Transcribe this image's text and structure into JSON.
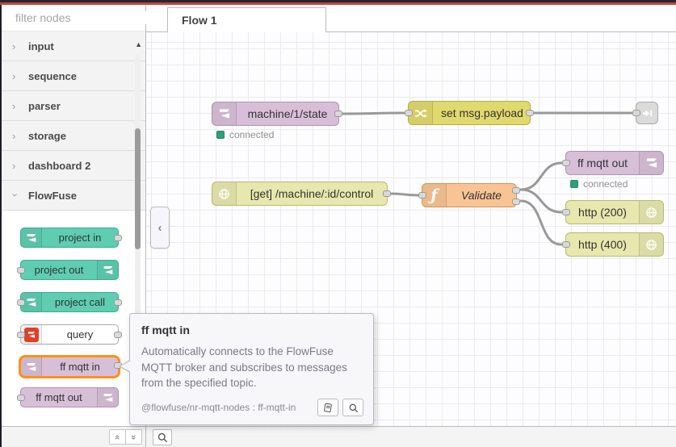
{
  "palette": {
    "search_placeholder": "filter nodes",
    "categories": [
      {
        "label": "input"
      },
      {
        "label": "sequence"
      },
      {
        "label": "parser"
      },
      {
        "label": "storage"
      },
      {
        "label": "dashboard 2"
      },
      {
        "label": "FlowFuse",
        "expanded": true
      }
    ],
    "nodes": [
      {
        "label": "project in"
      },
      {
        "label": "project out"
      },
      {
        "label": "project call"
      },
      {
        "label": "query"
      },
      {
        "label": "ff mqtt in",
        "highlighted": true
      },
      {
        "label": "ff mqtt out"
      }
    ]
  },
  "workspace": {
    "tab": {
      "label": "Flow 1"
    },
    "flow_nodes": [
      {
        "label": "machine/1/state",
        "type": "ff mqtt in",
        "status": "connected"
      },
      {
        "label": "set msg.payload",
        "type": "change"
      },
      {
        "label": "",
        "type": "link out"
      },
      {
        "label": "[get] /machine/:id/control",
        "type": "http in"
      },
      {
        "label": "Validate",
        "type": "function"
      },
      {
        "label": "ff mqtt out",
        "type": "ff mqtt out",
        "status": "connected"
      },
      {
        "label": "http (200)",
        "type": "http response"
      },
      {
        "label": "http (400)",
        "type": "http response"
      }
    ]
  },
  "tooltip": {
    "title": "ff mqtt in",
    "description": "Automatically connects to the FlowFuse MQTT broker and subscribes to messages from the specified topic.",
    "module": "@flowfuse/nr-mqtt-nodes : ff-mqtt-in"
  },
  "colors": {
    "mqtt_node": "#d8bfd8",
    "change_node": "#e2d96e",
    "http_node": "#e7e7ae",
    "function_node": "#f8c494",
    "project_node": "#5ecdb2",
    "link_node": "#dbdbdb",
    "status_green": "#2f9e7b",
    "highlight_orange": "#ff9016",
    "wire": "#999999",
    "header_red": "#c5423c"
  }
}
